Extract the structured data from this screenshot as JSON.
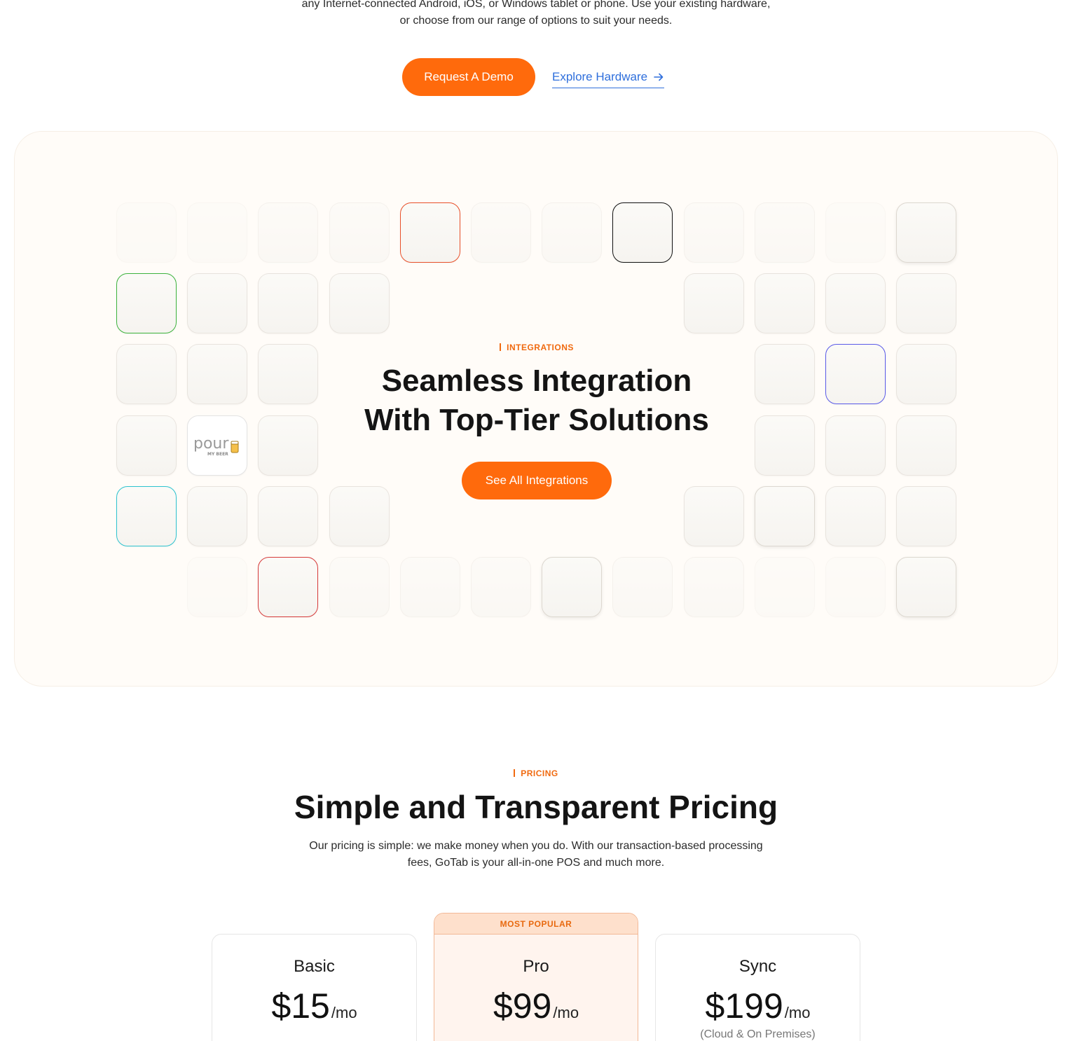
{
  "hero": {
    "line1": "any Internet-connected Android, iOS, or Windows tablet or phone. Use your existing hardware,",
    "line2": "or choose from our range of options to suit your needs.",
    "demo_button": "Request A Demo",
    "hardware_link": "Explore Hardware",
    "hardware_icon": "arrow-right-icon"
  },
  "integrations": {
    "eyebrow": "INTEGRATIONS",
    "title_line1": "Seamless Integration",
    "title_line2": "With Top-Tier Solutions",
    "button": "See All Integrations",
    "featured_logo": {
      "name": "pour-my-beer-logo",
      "text_main": "pour",
      "text_sub": "MY BEER"
    },
    "accent_colors": [
      "#e8502a",
      "#111111",
      "#3db33d",
      "#5a5ae8",
      "#2dc3cf",
      "#d63a3a"
    ],
    "brand_color": "#ff6a0c"
  },
  "pricing": {
    "eyebrow": "PRICING",
    "title": "Simple and Transparent Pricing",
    "desc_line1": "Our pricing is simple: we make money when you do. With our transaction-based processing",
    "desc_line2": "fees, GoTab is your all-in-one POS and much more.",
    "plans": [
      {
        "name": "Basic",
        "price": "$15",
        "period": "/mo",
        "note": ""
      },
      {
        "name": "Pro",
        "price": "$99",
        "period": "/mo",
        "note": "",
        "badge": "MOST POPULAR"
      },
      {
        "name": "Sync",
        "price": "$199",
        "period": "/mo",
        "note": "(Cloud & On Premises)"
      }
    ]
  }
}
